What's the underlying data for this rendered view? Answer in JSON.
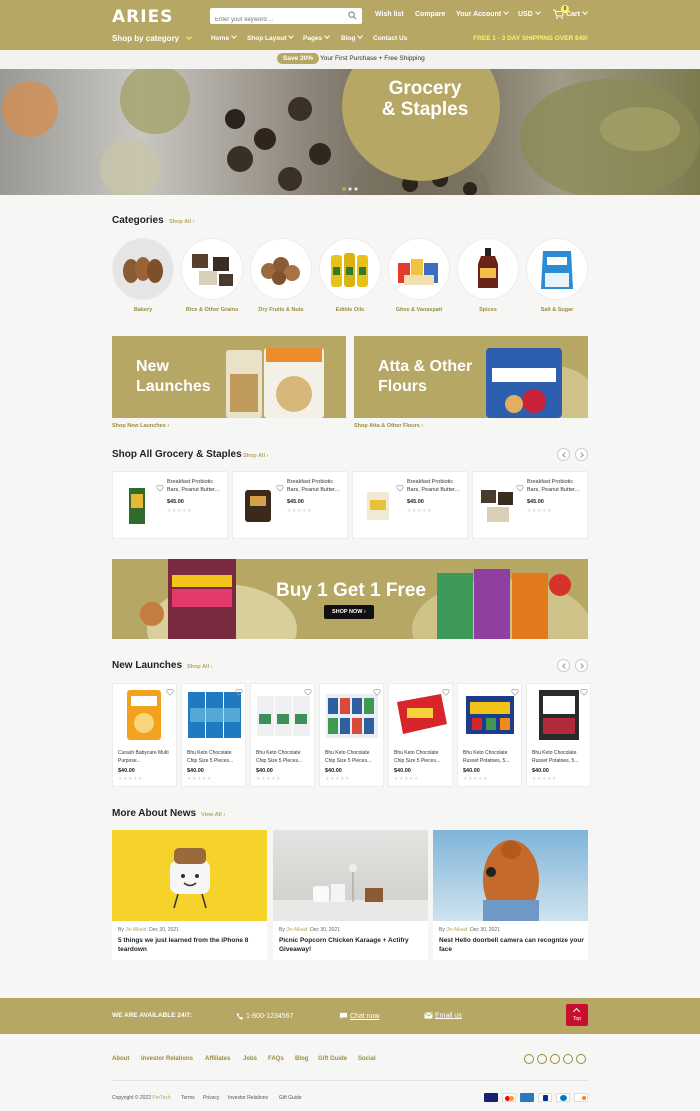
{
  "header": {
    "logo": "ARIES",
    "search_placeholder": "Enter your keyword ...",
    "wishlist": "Wish list",
    "compare": "Compare",
    "account": "Your Account",
    "currency": "USD",
    "cart_label": "Cart",
    "cart_count": "0",
    "shop_by_category": "Shop by category",
    "menu": [
      "Home",
      "Shop Layout",
      "Pages",
      "Blog",
      "Contact Us"
    ],
    "shipping_notice": "FREE 1 - 3 DAY SHIPPING OVER $49!"
  },
  "promo": {
    "badge": "Save 30%",
    "text": "Your First Purchase + Free Shipping"
  },
  "hero": {
    "title_line1": "Grocery",
    "title_line2": "& Staples"
  },
  "categories": {
    "title": "Categories",
    "link": "Shop All",
    "items": [
      "Bakery",
      "Rice & Other Grains",
      "Dry Fruits & Nuts",
      "Edible Oils",
      "Ghee & Vanaspati",
      "Spices",
      "Salt & Sugar"
    ]
  },
  "banners": [
    {
      "line1": "New",
      "line2": "Launches",
      "link": "Shop New Launches"
    },
    {
      "line1": "Atta & Other",
      "line2": "Flours",
      "link": "Shop Atta & Other Flours"
    }
  ],
  "shop_all": {
    "title": "Shop All Grocery & Staples",
    "link": "Shop All",
    "products": [
      {
        "name": "Breakfast Probiotic Bars, Peanut Butter...",
        "price": "$45.00"
      },
      {
        "name": "Breakfast Probiotic Bars, Peanut Butter...",
        "price": "$45.00"
      },
      {
        "name": "Breakfast Probiotic Bars, Peanut Butter...",
        "price": "$45.00"
      },
      {
        "name": "Breakfast Probiotic Bars, Peanut Butter...",
        "price": "$45.00"
      }
    ]
  },
  "bogo": {
    "title": "Buy 1 Get 1 Free",
    "button": "SHOP NOW"
  },
  "new_launches": {
    "title": "New Launches",
    "link": "Shop All",
    "products": [
      {
        "name": "Curash Babycare Multi Purpose...",
        "price": "$40.00"
      },
      {
        "name": "Bhu Keto Chocolate Chip Size 5 Pieces...",
        "price": "$40.00"
      },
      {
        "name": "Bhu Keto Chocolate Chip Size 5 Pieces...",
        "price": "$40.00"
      },
      {
        "name": "Bhu Keto Chocolate Chip Size 5 Pieces...",
        "price": "$40.00"
      },
      {
        "name": "Bhu Keto Chocolate Chip Size 5 Pieces...",
        "price": "$40.00"
      },
      {
        "name": "Bhu Keto Chocolate Russet Potatoes, 5...",
        "price": "$40.00"
      },
      {
        "name": "Bhu Keto Chocolate Russet Potatoes, 5...",
        "price": "$40.00"
      }
    ]
  },
  "news": {
    "title": "More About News",
    "link": "View All",
    "posts": [
      {
        "by": "By",
        "author": "Jin Alkaid",
        "date": "Dec 30, 2021",
        "title": "5 things we just learned from the iPhone 8 teardown"
      },
      {
        "by": "By",
        "author": "Jin Alkaid",
        "date": "Dec 30, 2021",
        "title": "Picnic Popcorn Chicken Karaage + Actifry Giveaway!"
      },
      {
        "by": "By",
        "author": "Jin Alkaid",
        "date": "Dec 30, 2021",
        "title": "Nest Hello doorbell camera can recognize your face"
      }
    ]
  },
  "footer": {
    "available": "WE ARE AVAILABLE 24/7:",
    "phone": "1-800-1234567",
    "chat": "Chat now",
    "email": "Email us",
    "top": "Top",
    "links": [
      "About",
      "Investor Relations",
      "Affiliates",
      "Jobs",
      "FAQs",
      "Blog",
      "Gift Guide",
      "Social"
    ],
    "copyright": "Copyright © 2022",
    "brand": "PerTech",
    "bottom_links": [
      "Terms",
      "Privacy",
      "Investor Relations",
      "Gift Guide"
    ]
  },
  "colors": {
    "brand": "#b6a864",
    "accent_red": "#c8102e",
    "shipping_yellow": "#ffef6e"
  }
}
